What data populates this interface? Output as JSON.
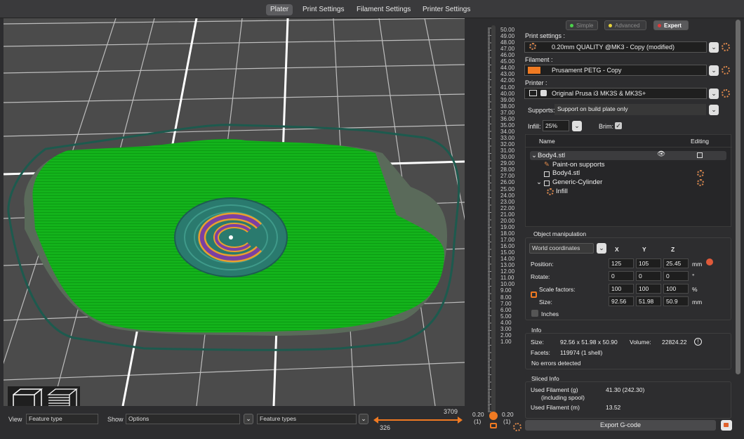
{
  "tabs": [
    "Plater",
    "Print Settings",
    "Filament Settings",
    "Printer Settings"
  ],
  "mode": {
    "simple": "Simple",
    "advanced": "Advanced",
    "expert": "Expert"
  },
  "print_settings": {
    "label": "Print settings :",
    "value": "0.20mm QUALITY @MK3 - Copy (modified)"
  },
  "filament": {
    "label": "Filament :",
    "value": "Prusament PETG - Copy",
    "color": "#f07a22"
  },
  "printer": {
    "label": "Printer :",
    "value": "Original Prusa i3 MK3S & MK3S+"
  },
  "supports": {
    "label": "Supports:",
    "value": "Support on build plate only"
  },
  "infill": {
    "label": "Infill:",
    "value": "25%"
  },
  "brim": {
    "label": "Brim:"
  },
  "objects": {
    "col_name": "Name",
    "col_editing": "Editing",
    "items": [
      "Body4.stl",
      "Paint-on supports",
      "Body4.stl",
      "Generic-Cylinder",
      "Infill"
    ]
  },
  "object_manipulation": {
    "title": "Object manipulation",
    "coord": "World coordinates",
    "x": "X",
    "y": "Y",
    "z": "Z",
    "position_label": "Position:",
    "position": [
      "125",
      "105",
      "25.45"
    ],
    "rotate_label": "Rotate:",
    "rotate": [
      "0",
      "0",
      "0"
    ],
    "scale_label": "Scale factors:",
    "scale": [
      "100",
      "100",
      "100"
    ],
    "size_label": "Size:",
    "size": [
      "92.56",
      "51.98",
      "50.9"
    ],
    "unit_mm": "mm",
    "unit_deg": "°",
    "unit_pct": "%",
    "inches": "Inches"
  },
  "info": {
    "title": "Info",
    "size_label": "Size:",
    "size": "92.56 x 51.98 x 50.90",
    "volume_label": "Volume:",
    "volume": "22824.22",
    "facets_label": "Facets:",
    "facets": "119974 (1 shell)",
    "errors": "No errors detected"
  },
  "sliced_info": {
    "title": "Sliced Info",
    "filament_g_label": "Used Filament (g)",
    "filament_g_sub": "(including spool)",
    "filament_g": "41.30 (242.30)",
    "filament_m_label": "Used Filament (m)",
    "filament_m": "13.52"
  },
  "export": "Export G-code",
  "bottom": {
    "view_label": "View",
    "view_value": "Feature type",
    "show_label": "Show",
    "show_value": "Options",
    "feature_value": "Feature types",
    "range_max": "3709",
    "range_min": "326"
  },
  "slider": {
    "ticks": [
      "50.00",
      "49.00",
      "48.00",
      "47.00",
      "46.00",
      "45.00",
      "44.00",
      "43.00",
      "42.00",
      "41.00",
      "40.00",
      "39.00",
      "38.00",
      "37.00",
      "36.00",
      "35.00",
      "34.00",
      "33.00",
      "32.00",
      "31.00",
      "30.00",
      "29.00",
      "28.00",
      "27.00",
      "26.00",
      "25.00",
      "24.00",
      "23.00",
      "22.00",
      "21.00",
      "20.00",
      "19.00",
      "18.00",
      "17.00",
      "16.00",
      "15.00",
      "14.00",
      "13.00",
      "12.00",
      "11.00",
      "10.00",
      "9.00",
      "8.00",
      "7.00",
      "6.00",
      "5.00",
      "4.00",
      "3.00",
      "2.00",
      "1.00"
    ],
    "bottom_left": "0.20",
    "bottom_left_sub": "(1)",
    "bottom_right": "0.20",
    "bottom_right_sub": "(1)"
  },
  "colors": {
    "green": "#12b81a",
    "purple": "#7b3fa3",
    "orange": "#e8a02e",
    "teal": "#2a7a6e",
    "accent": "#f07a22"
  }
}
